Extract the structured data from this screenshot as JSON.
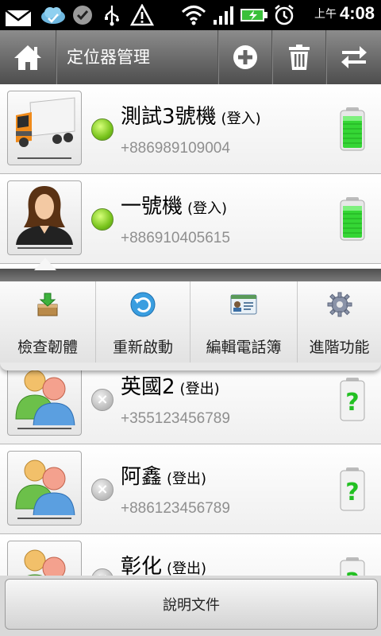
{
  "status_bar": {
    "time": "4:08",
    "ampm": "上午",
    "icons": [
      "mail-icon",
      "cloud-icon",
      "chat-icon",
      "usb-icon",
      "warning-icon",
      "wifi-icon",
      "signal-icon",
      "battery-charging-icon",
      "alarm-icon"
    ]
  },
  "title_bar": {
    "title": "定位器管理",
    "icons": [
      "home-icon",
      "add-icon",
      "trash-icon",
      "swap-icon"
    ]
  },
  "devices": [
    {
      "name": "測試3號機",
      "status": "(登入)",
      "phone": "+886989109004",
      "online": true,
      "avatar": "truck-icon",
      "battery": "full"
    },
    {
      "name": "一號機",
      "status": "(登入)",
      "phone": "+886910405615",
      "online": true,
      "avatar": "person-icon",
      "battery": "full"
    },
    {
      "name": "英國2",
      "status": "(登出)",
      "phone": "+355123456789",
      "online": false,
      "avatar": "group-icon",
      "battery": "unknown"
    },
    {
      "name": "阿鑫",
      "status": "(登出)",
      "phone": "+886123456789",
      "online": false,
      "avatar": "group-icon",
      "battery": "unknown"
    },
    {
      "name": "彰化",
      "status": "(登出)",
      "phone": "",
      "online": false,
      "avatar": "group-icon",
      "battery": "unknown"
    }
  ],
  "popup_menu": {
    "items": [
      {
        "label": "檢查韌體",
        "icon": "firmware-download-icon"
      },
      {
        "label": "重新啟動",
        "icon": "restart-icon"
      },
      {
        "label": "編輯電話簿",
        "icon": "contact-card-icon"
      },
      {
        "label": "進階功能",
        "icon": "gear-icon"
      }
    ]
  },
  "bottom": {
    "help_label": "說明文件"
  },
  "colors": {
    "online": "#79c41d",
    "offline": "#b9b9b9",
    "battery_green": "#35d635",
    "titlebar_dark": "#4d4d4d"
  }
}
